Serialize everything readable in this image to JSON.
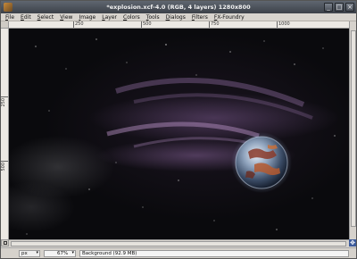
{
  "window": {
    "title": "*explosion.xcf-4.0 (RGB, 4 layers) 1280x800",
    "buttons": [
      "_",
      "□",
      "×"
    ]
  },
  "menu": [
    "File",
    "Edit",
    "Select",
    "View",
    "Image",
    "Layer",
    "Colors",
    "Tools",
    "Dialogs",
    "Filters",
    "FX-Foundry"
  ],
  "rulers": {
    "horizontal": [
      "250",
      "500",
      "750",
      "1000"
    ],
    "vertical": [
      "250",
      "500"
    ]
  },
  "status": {
    "coords": "px",
    "zoom": "67%",
    "message": "Background (92.9 MB)"
  },
  "icons": {
    "navigate": "navigate-icon",
    "quickmask": "quick-mask-icon"
  }
}
